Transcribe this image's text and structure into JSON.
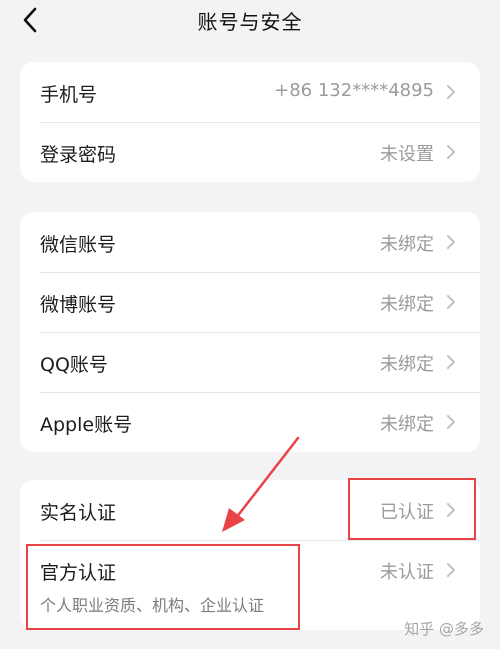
{
  "header": {
    "title": "账号与安全"
  },
  "account_card": {
    "rows": [
      {
        "label": "手机号",
        "value": "+86 132****4895"
      },
      {
        "label": "登录密码",
        "value": "未设置"
      }
    ]
  },
  "bindings_card": {
    "rows": [
      {
        "label": "微信账号",
        "value": "未绑定"
      },
      {
        "label": "微博账号",
        "value": "未绑定"
      },
      {
        "label": "QQ账号",
        "value": "未绑定"
      },
      {
        "label": "Apple账号",
        "value": "未绑定"
      }
    ]
  },
  "verification_card": {
    "rows": [
      {
        "label": "实名认证",
        "value": "已认证"
      },
      {
        "label": "官方认证",
        "value": "未认证",
        "subtitle": "个人职业资质、机构、企业认证"
      }
    ]
  },
  "annotations": {
    "highlight_color": "#e94348"
  },
  "watermark": {
    "text": "知乎 @多多"
  },
  "icons": {
    "back": "back-chevron-icon",
    "row_arrow": "chevron-right-icon"
  }
}
